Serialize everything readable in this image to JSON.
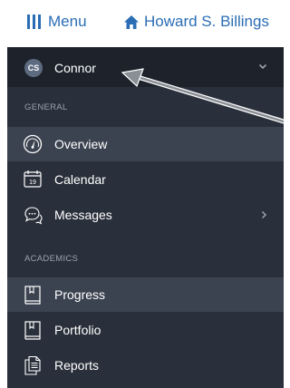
{
  "topbar": {
    "menu_label": "Menu",
    "school_label": "Howard S. Billings"
  },
  "user": {
    "initials": "CS",
    "name": "Connor"
  },
  "sections": {
    "general": "GENERAL",
    "academics": "ACADEMICS"
  },
  "nav": {
    "overview": {
      "label": "Overview",
      "icon": "dashboard-gauge-icon"
    },
    "calendar": {
      "label": "Calendar",
      "icon": "calendar-icon"
    },
    "messages": {
      "label": "Messages",
      "icon": "chat-bubbles-icon"
    },
    "progress": {
      "label": "Progress",
      "icon": "book-icon"
    },
    "portfolio": {
      "label": "Portfolio",
      "icon": "book-icon"
    },
    "reports": {
      "label": "Reports",
      "icon": "documents-icon"
    }
  },
  "calendar_icon_day": "19",
  "colors": {
    "link": "#2a6db5",
    "sidebar": "#2a303b",
    "user_row": "#1d222b",
    "active_item": "#3c4350",
    "section_text": "#9aa3b0",
    "annotation_arrow": "#8a8f96"
  }
}
